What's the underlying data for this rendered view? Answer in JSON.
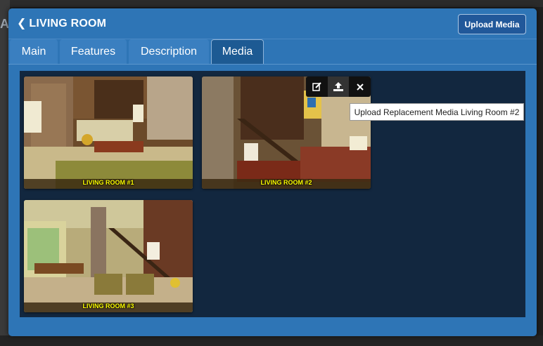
{
  "background": {
    "heading": "A"
  },
  "modal": {
    "title": "LIVING ROOM",
    "back_icon": "chevron-left-icon",
    "upload_button": "Upload Media"
  },
  "tabs": [
    {
      "label": "Main",
      "active": false
    },
    {
      "label": "Features",
      "active": false
    },
    {
      "label": "Description",
      "active": false
    },
    {
      "label": "Media",
      "active": true
    }
  ],
  "media": [
    {
      "caption": "LIVING ROOM #1"
    },
    {
      "caption": "LIVING ROOM #2"
    },
    {
      "caption": "LIVING ROOM #3"
    }
  ],
  "toolbar": {
    "items": [
      "edit-icon",
      "upload-icon",
      "close-icon"
    ]
  },
  "tooltip": "Upload Replacement Media Living Room #2",
  "colors": {
    "modal": "#2e75b6",
    "panel": "#12273f",
    "caption": "#ffff00",
    "active_tab": "#1d5a93"
  }
}
